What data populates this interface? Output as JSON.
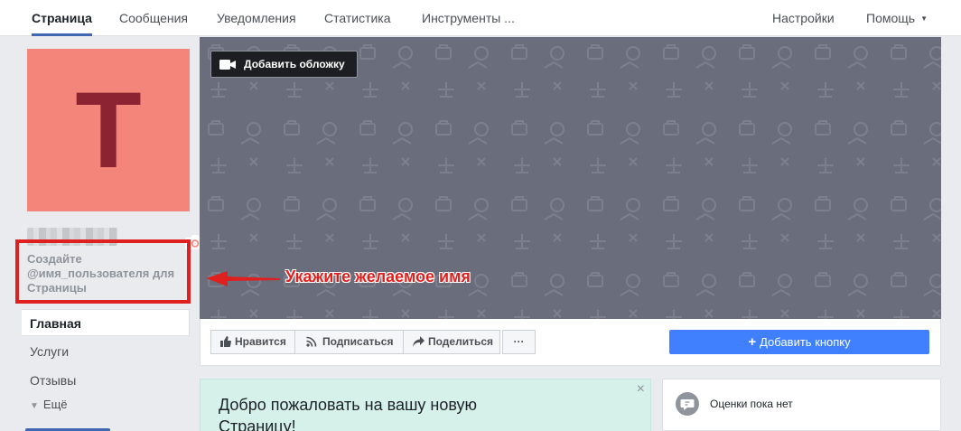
{
  "nav": {
    "tabs": [
      {
        "label": "Страница",
        "active": true
      },
      {
        "label": "Сообщения"
      },
      {
        "label": "Уведомления"
      },
      {
        "label": "Статистика"
      },
      {
        "label": "Инструменты ..."
      }
    ],
    "settings": "Настройки",
    "help": "Помощь"
  },
  "profile": {
    "avatar_letter": "T",
    "avatar_bg": "#f3857b",
    "avatar_fg": "#8b2332",
    "username_prompt": "Создайте @имя_пользователя для Страницы"
  },
  "leftnav": {
    "items": [
      "Главная",
      "Услуги",
      "Отзывы"
    ],
    "more": "Ещё"
  },
  "annotation": {
    "text": "Укажите желаемое имя",
    "color": "#e0201e"
  },
  "cover": {
    "add_cover": "Добавить обложку",
    "bg": "#6a6e7c"
  },
  "actions": {
    "like": "Нравится",
    "subscribe": "Подписаться",
    "share": "Поделиться",
    "more": "···",
    "add_button": "Добавить кнопку"
  },
  "welcome": {
    "text": "Добро пожаловать на вашу новую Страницу!",
    "close": "×"
  },
  "reviews": {
    "text": "Оценки пока нет"
  }
}
